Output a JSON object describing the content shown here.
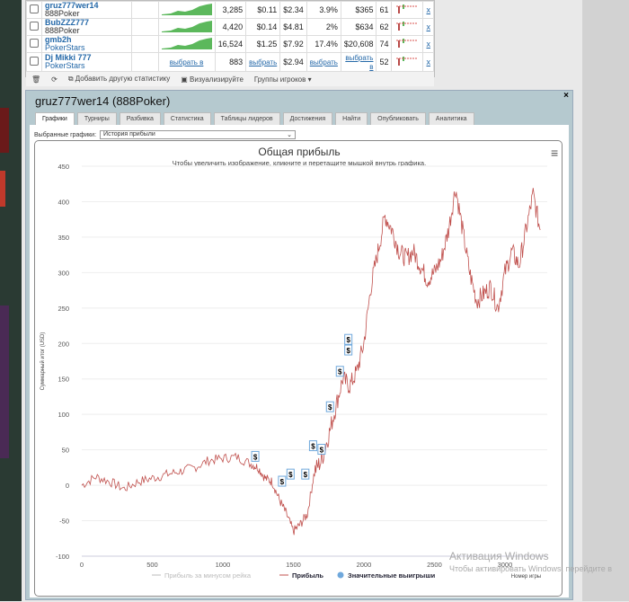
{
  "players": [
    {
      "name": "gruz777wer14",
      "site": "888Poker",
      "hands": "3,285",
      "c1": "$0.11",
      "c2": "$2.34",
      "c3": "3.9%",
      "c4": "$365",
      "c5": "61",
      "remove": "x"
    },
    {
      "name": "BubZZZ777",
      "site": "888Poker",
      "hands": "4,420",
      "c1": "$0.14",
      "c2": "$4.81",
      "c3": "2%",
      "c4": "$634",
      "c5": "62",
      "remove": "x"
    },
    {
      "name": "gmb2h",
      "site": "PokerStars",
      "hands": "16,524",
      "c1": "$1.25",
      "c2": "$7.92",
      "c3": "17.4%",
      "c4": "$20,608",
      "c5": "74",
      "remove": "x"
    },
    {
      "name": "Dj Mikki 777",
      "site": "PokerStars",
      "spark": "выбрать в",
      "hands": "883",
      "c1": "выбрать",
      "c2": "$2.94",
      "c3": "выбрать",
      "c4": "выбрать в",
      "c5": "52",
      "remove": "x"
    }
  ],
  "footer": {
    "add_stat": "Добавить другую статистику",
    "visualize": "Визуализируйте",
    "groups": "Группы игроков"
  },
  "panel": {
    "title": "gruz777wer14 (888Poker)",
    "close": "×",
    "tabs": [
      "Графики",
      "Турниры",
      "Разбивка",
      "Статистика",
      "Таблицы лидеров",
      "Достижения",
      "Найти",
      "Опубликовать",
      "Аналитика"
    ],
    "selected_label": "Выбранные графики:",
    "selected_value": "История прибыли"
  },
  "chart_data": {
    "type": "line",
    "title": "Общая прибыль",
    "subtitle": "Чтобы увеличить изображение, кликните и перетащите мышкой внутрь графика.",
    "xlabel": "Номер игры",
    "ylabel": "Суммарный итог (USD)",
    "xlim": [
      0,
      3300
    ],
    "ylim": [
      -100,
      450
    ],
    "xticks": [
      0,
      500,
      1000,
      1500,
      2000,
      2500,
      3000
    ],
    "yticks": [
      -100,
      -50,
      0,
      50,
      100,
      150,
      200,
      250,
      300,
      350,
      400,
      450
    ],
    "legend": [
      "Прибыль за минусом рейка",
      "Прибыль",
      "Значительные выигрыши"
    ],
    "legend_position": "bottom",
    "series": [
      {
        "name": "Прибыль",
        "color": "#c0504d",
        "x": [
          0,
          100,
          200,
          300,
          400,
          500,
          600,
          700,
          800,
          900,
          1000,
          1100,
          1200,
          1250,
          1300,
          1350,
          1400,
          1450,
          1500,
          1550,
          1600,
          1650,
          1700,
          1750,
          1800,
          1850,
          1900,
          1950,
          2000,
          2050,
          2100,
          2150,
          2200,
          2250,
          2300,
          2350,
          2400,
          2450,
          2500,
          2550,
          2600,
          2650,
          2700,
          2750,
          2800,
          2850,
          2900,
          2950,
          3000,
          3050,
          3100,
          3150,
          3200,
          3250
        ],
        "y": [
          0,
          12,
          5,
          -5,
          5,
          10,
          15,
          20,
          25,
          35,
          38,
          40,
          30,
          25,
          10,
          5,
          -20,
          -40,
          -65,
          -55,
          -40,
          20,
          35,
          70,
          110,
          150,
          140,
          160,
          200,
          280,
          330,
          380,
          360,
          330,
          320,
          330,
          310,
          290,
          300,
          320,
          360,
          420,
          360,
          300,
          260,
          270,
          280,
          250,
          300,
          330,
          310,
          360,
          410,
          360
        ]
      }
    ],
    "significant_wins": {
      "marker": "$",
      "x": [
        1230,
        1420,
        1480,
        1585,
        1640,
        1700,
        1760,
        1830,
        1890,
        1890
      ],
      "y": [
        30,
        -5,
        5,
        5,
        45,
        40,
        100,
        150,
        180,
        195
      ]
    }
  },
  "watermark": {
    "title": "Активация Windows",
    "text": "Чтобы активировать Windows, перейдите в"
  }
}
